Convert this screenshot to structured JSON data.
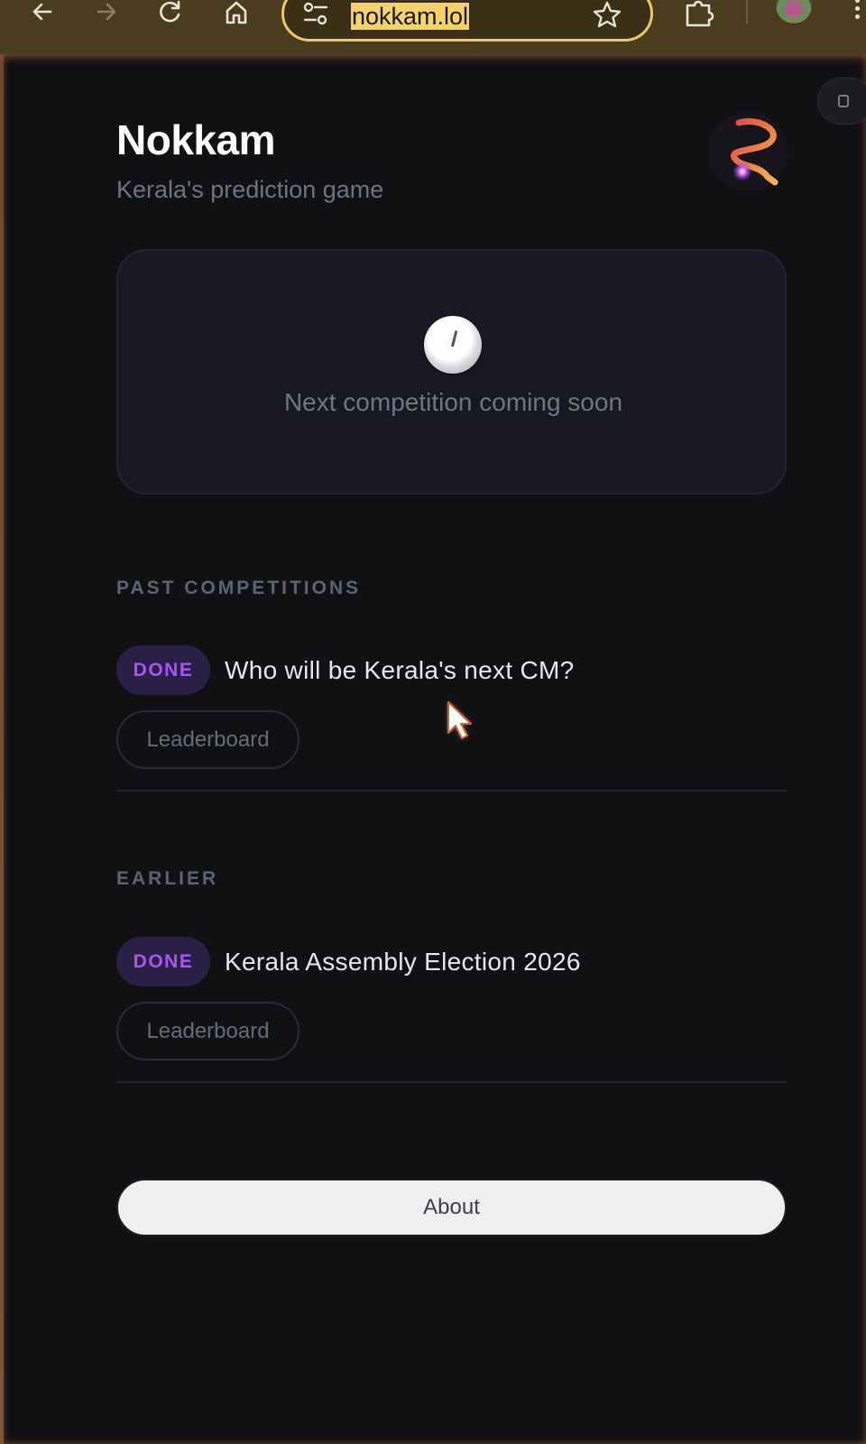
{
  "browser": {
    "url": "nokkam.lol",
    "icons": [
      "back-arrow-icon",
      "forward-arrow-icon",
      "reload-icon",
      "home-icon",
      "site-settings-icon",
      "bookmark-star-icon",
      "extensions-icon",
      "profile-avatar",
      "menu-dots-icon"
    ]
  },
  "site": {
    "title": "Nokkam",
    "subtitle": "Kerala's prediction game"
  },
  "upcoming": {
    "icon": "clock-icon",
    "message": "Next competition coming soon"
  },
  "past": {
    "heading": "PAST COMPETITIONS",
    "items": [
      {
        "status": "DONE",
        "title": "Who will be Kerala's next CM?",
        "button": "Leaderboard"
      }
    ]
  },
  "earlier": {
    "heading": "EARLIER",
    "items": [
      {
        "status": "DONE",
        "title": "Kerala Assembly Election 2026",
        "button": "Leaderboard"
      }
    ]
  },
  "footer": {
    "about_label": "About"
  },
  "colors": {
    "background": "#111114",
    "card": "#181822",
    "badge_text": "#a855f7",
    "badge_bg": "#2a1f45",
    "url_highlight": "#f4d36a"
  }
}
